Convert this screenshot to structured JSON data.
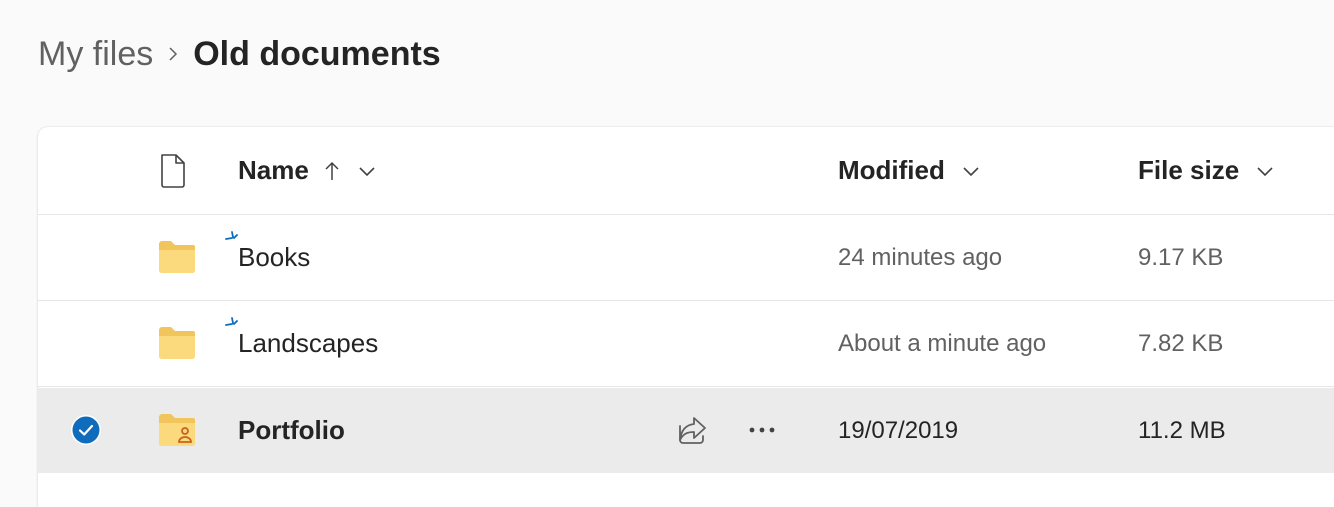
{
  "breadcrumb": {
    "root": "My files",
    "current": "Old documents"
  },
  "columns": {
    "name": "Name",
    "modified": "Modified",
    "file_size": "File size"
  },
  "rows": [
    {
      "name": "Books",
      "modified": "24 minutes ago",
      "size": "9.17 KB",
      "icon": "folder-icon",
      "new": true,
      "selected": false
    },
    {
      "name": "Landscapes",
      "modified": "About a minute ago",
      "size": "7.82 KB",
      "icon": "folder-icon",
      "new": true,
      "selected": false
    },
    {
      "name": "Portfolio",
      "modified": "19/07/2019",
      "size": "11.2 MB",
      "icon": "shared-folder-icon",
      "new": false,
      "selected": true
    }
  ],
  "colors": {
    "accent": "#0f6cbd",
    "folder": "#f8d775",
    "selected_row": "#ebebeb"
  }
}
